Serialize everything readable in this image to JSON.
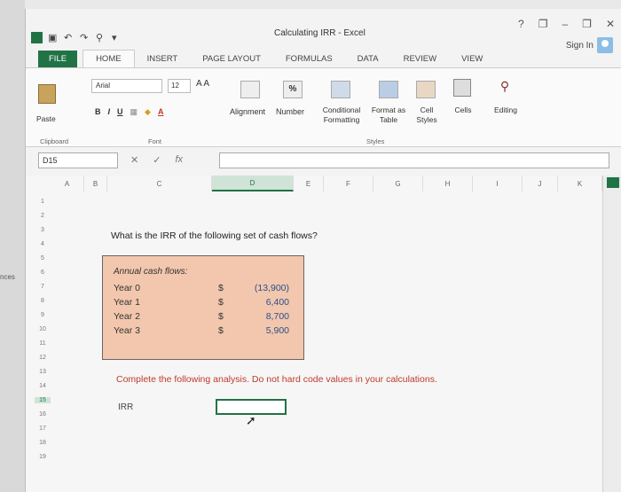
{
  "window": {
    "title": "Calculating IRR - Excel"
  },
  "controls": {
    "help": "?",
    "minimize": "–",
    "restore": "❐",
    "close": "✕",
    "sign_in": "Sign In"
  },
  "tabs": [
    {
      "label": "FILE"
    },
    {
      "label": "HOME"
    },
    {
      "label": "INSERT"
    },
    {
      "label": "PAGE LAYOUT"
    },
    {
      "label": "FORMULAS"
    },
    {
      "label": "DATA"
    },
    {
      "label": "REVIEW"
    },
    {
      "label": "VIEW"
    }
  ],
  "ribbon": {
    "paste": "Paste",
    "clipboard": "Clipboard",
    "font_name": "Arial",
    "font_size": "12",
    "grow_shrink": "A A",
    "bold": "B",
    "italic": "I",
    "underline": "U",
    "font_group": "Font",
    "alignment": "Alignment",
    "number": "Number",
    "number_symbol": "%",
    "conditional_formatting": "Conditional Formatting",
    "format_as_table": "Format as Table",
    "cell_styles": "Cell Styles",
    "styles_group": "Styles",
    "cells": "Cells",
    "editing": "Editing"
  },
  "formula_bar": {
    "name_box": "D15",
    "cancel": "✕",
    "enter": "✓",
    "fx": "fx",
    "value": ""
  },
  "columns": [
    "A",
    "B",
    "C",
    "D",
    "E",
    "F",
    "G",
    "H",
    "I",
    "J",
    "K"
  ],
  "rows": [
    "1",
    "2",
    "3",
    "4",
    "5",
    "6",
    "7",
    "8",
    "9",
    "10",
    "11",
    "12",
    "13",
    "14",
    "15",
    "16",
    "17",
    "18",
    "19"
  ],
  "sheet": {
    "question": "What is the IRR of the following set of cash flows?",
    "cash_flows_title": "Annual cash flows:",
    "cash_flows": [
      {
        "label": "Year 0",
        "currency": "$",
        "value": "(13,900)"
      },
      {
        "label": "Year 1",
        "currency": "$",
        "value": "6,400"
      },
      {
        "label": "Year 2",
        "currency": "$",
        "value": "8,700"
      },
      {
        "label": "Year 3",
        "currency": "$",
        "value": "5,900"
      }
    ],
    "instruction": "Complete the following analysis. Do not hard code values in your calculations.",
    "irr_label": "IRR"
  },
  "desktop_hint": "nces"
}
